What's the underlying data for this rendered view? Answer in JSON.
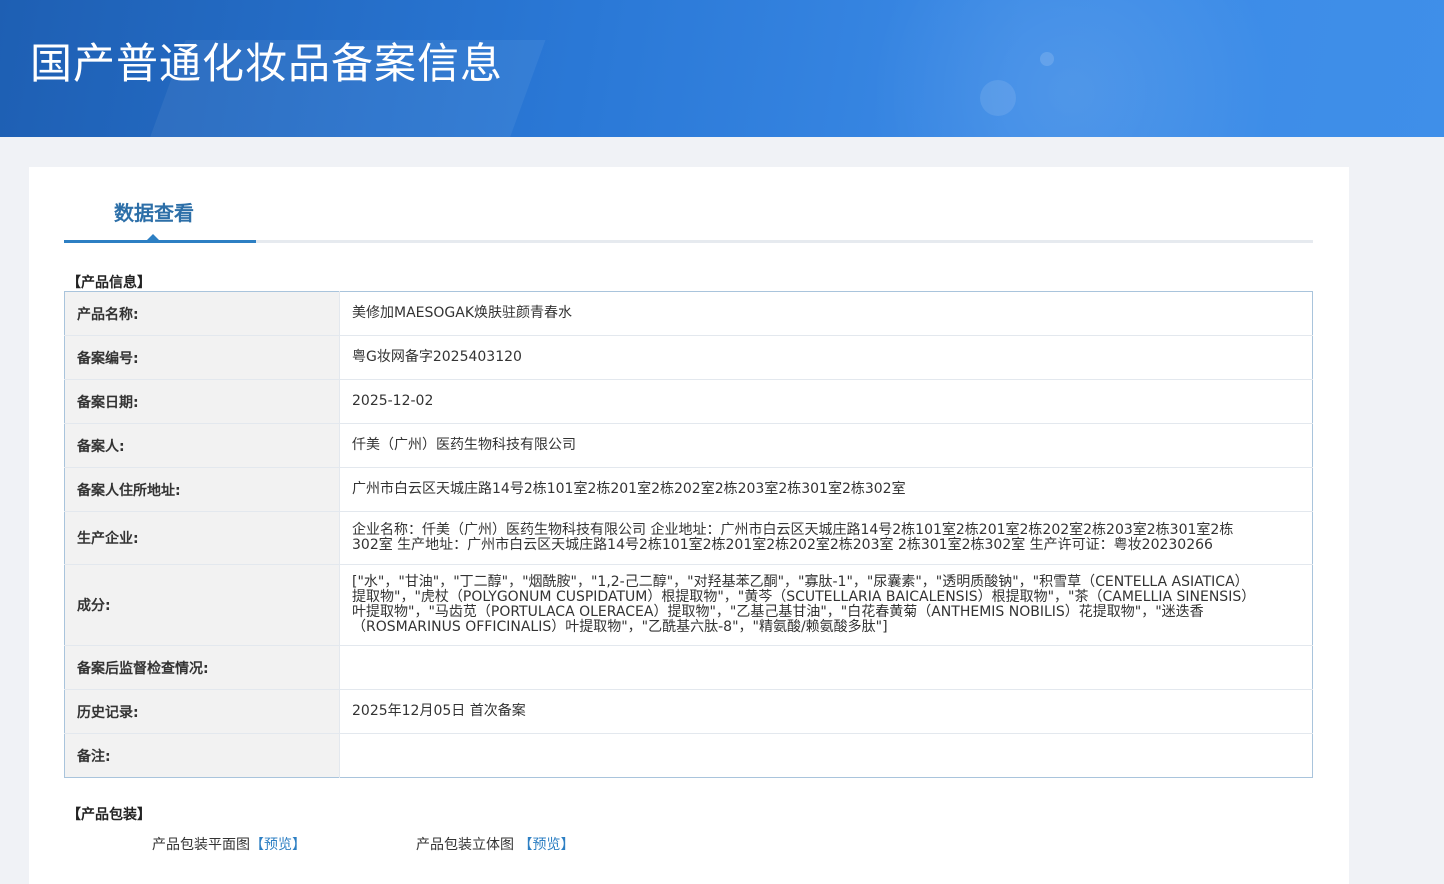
{
  "banner": {
    "title": "国产普通化妆品备案信息"
  },
  "tab": {
    "label": "数据查看"
  },
  "product_info": {
    "section_title": "【产品信息】",
    "rows": [
      {
        "label": "产品名称:",
        "value": "美修加MAESOGAK焕肤驻颜青春水"
      },
      {
        "label": "备案编号:",
        "value": "粤G妆网备字2025403120"
      },
      {
        "label": "备案日期:",
        "value": "2025-12-02"
      },
      {
        "label": "备案人:",
        "value": "仟美（广州）医药生物科技有限公司"
      },
      {
        "label": "备案人住所地址:",
        "value": "广州市白云区天城庄路14号2栋101室2栋201室2栋202室2栋203室2栋301室2栋302室"
      },
      {
        "label": "生产企业:",
        "value": "企业名称：仟美（广州）医药生物科技有限公司 企业地址：广州市白云区天城庄路14号2栋101室2栋201室2栋202室2栋203室2栋301室2栋302室 生产地址：广州市白云区天城庄路14号2栋101室2栋201室2栋202室2栋203室 2栋301室2栋302室 生产许可证：粤妆20230266"
      },
      {
        "label": "成分:",
        "value": "[\"水\"，\"甘油\"，\"丁二醇\"，\"烟酰胺\"，\"1,2-己二醇\"，\"对羟基苯乙酮\"，\"寡肽-1\"，\"尿囊素\"，\"透明质酸钠\"，\"积雪草（CENTELLA ASIATICA）提取物\"，\"虎杖（POLYGONUM CUSPIDATUM）根提取物\"，\"黄芩（SCUTELLARIA BAICALENSIS）根提取物\"，\"茶（CAMELLIA SINENSIS）叶提取物\"，\"马齿苋（PORTULACA OLERACEA）提取物\"，\"乙基己基甘油\"，\"白花春黄菊（ANTHEMIS NOBILIS）花提取物\"，\"迷迭香（ROSMARINUS OFFICINALIS）叶提取物\"，\"乙酰基六肽-8\"，\"精氨酸/赖氨酸多肽\"]"
      },
      {
        "label": "备案后监督检查情况:",
        "value": ""
      },
      {
        "label": "历史记录:",
        "value": "2025年12月05日 首次备案"
      },
      {
        "label": "备注:",
        "value": ""
      }
    ]
  },
  "packaging": {
    "section_title": "【产品包装】",
    "flat_label": "产品包装平面图",
    "stereo_label": "产品包装立体图",
    "preview_link": "【预览】"
  }
}
